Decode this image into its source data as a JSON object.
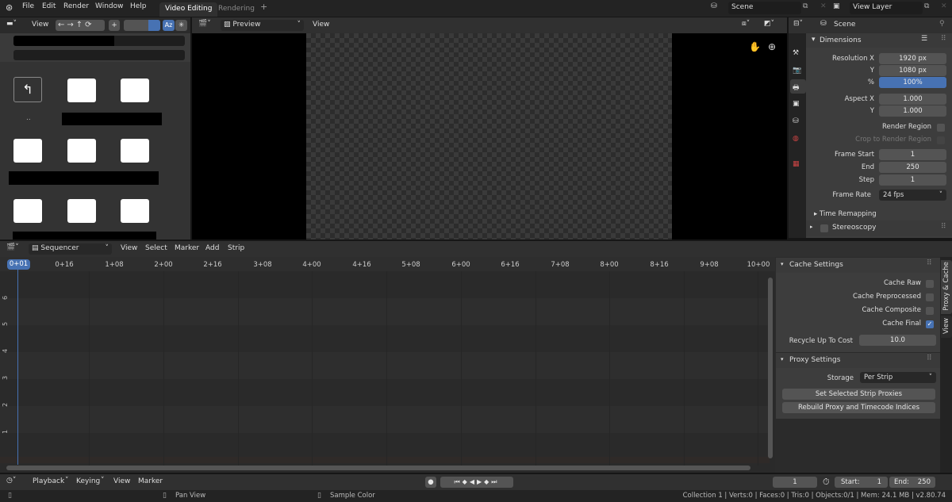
{
  "topbar": {
    "menus": [
      "File",
      "Edit",
      "Render",
      "Window",
      "Help"
    ],
    "workspaces": [
      "Video Editing",
      "Rendering"
    ],
    "active_workspace": "Video Editing",
    "add_tab": "+",
    "scene": "Scene",
    "view_layer": "View Layer"
  },
  "file_browser": {
    "view_label": "View",
    "parent_label": ".."
  },
  "preview": {
    "mode": "Preview",
    "view_label": "View"
  },
  "properties": {
    "context": "Scene",
    "panel": "Dimensions",
    "fields": [
      {
        "label": "Resolution X",
        "value": "1920 px"
      },
      {
        "label": "Y",
        "value": "1080 px"
      },
      {
        "label": "%",
        "value": "100%"
      },
      {
        "label": "Aspect X",
        "value": "1.000"
      },
      {
        "label": "Y",
        "value": "1.000"
      }
    ],
    "render_region": "Render Region",
    "crop_region": "Crop to Render Region",
    "frames": [
      {
        "label": "Frame Start",
        "value": "1"
      },
      {
        "label": "End",
        "value": "250"
      },
      {
        "label": "Step",
        "value": "1"
      }
    ],
    "frame_rate_label": "Frame Rate",
    "frame_rate": "24 fps",
    "time_remapping": "Time Remapping",
    "stereoscopy": "Stereoscopy"
  },
  "sequencer": {
    "mode": "Sequencer",
    "menus": [
      "View",
      "Select",
      "Marker",
      "Add",
      "Strip"
    ],
    "ruler": [
      "0+01",
      "0+16",
      "1+08",
      "2+00",
      "2+16",
      "3+08",
      "4+00",
      "4+16",
      "5+08",
      "6+00",
      "6+16",
      "7+08",
      "8+00",
      "8+16",
      "9+08",
      "10+00"
    ],
    "channels": [
      "6",
      "5",
      "4",
      "3",
      "2",
      "1"
    ]
  },
  "sidebar": {
    "tabs": [
      "Proxy & Cache",
      "View"
    ],
    "cache_title": "Cache Settings",
    "cache": [
      {
        "label": "Cache Raw",
        "checked": false
      },
      {
        "label": "Cache Preprocessed",
        "checked": false
      },
      {
        "label": "Cache Composite",
        "checked": false
      },
      {
        "label": "Cache Final",
        "checked": true
      }
    ],
    "recycle_label": "Recycle Up To Cost",
    "recycle_value": "10.0",
    "proxy_title": "Proxy Settings",
    "storage_label": "Storage",
    "storage_value": "Per Strip",
    "set_proxies": "Set Selected Strip Proxies",
    "rebuild": "Rebuild Proxy and Timecode Indices",
    "check_glyph": "✓"
  },
  "timeline": {
    "menus": [
      "Playback",
      "Keying",
      "View",
      "Marker"
    ],
    "current_frame": "1",
    "start_label": "Start:",
    "start": "1",
    "end_label": "End:",
    "end": "250"
  },
  "status": {
    "left": "Pan View",
    "middle": "Sample Color",
    "right": "Collection 1 | Verts:0 | Faces:0 | Tris:0 | Objects:0/1 | Mem: 24.1 MB | v2.80.74"
  },
  "colors": {
    "accent": "#4772b3",
    "playhead": "#4772b3"
  }
}
